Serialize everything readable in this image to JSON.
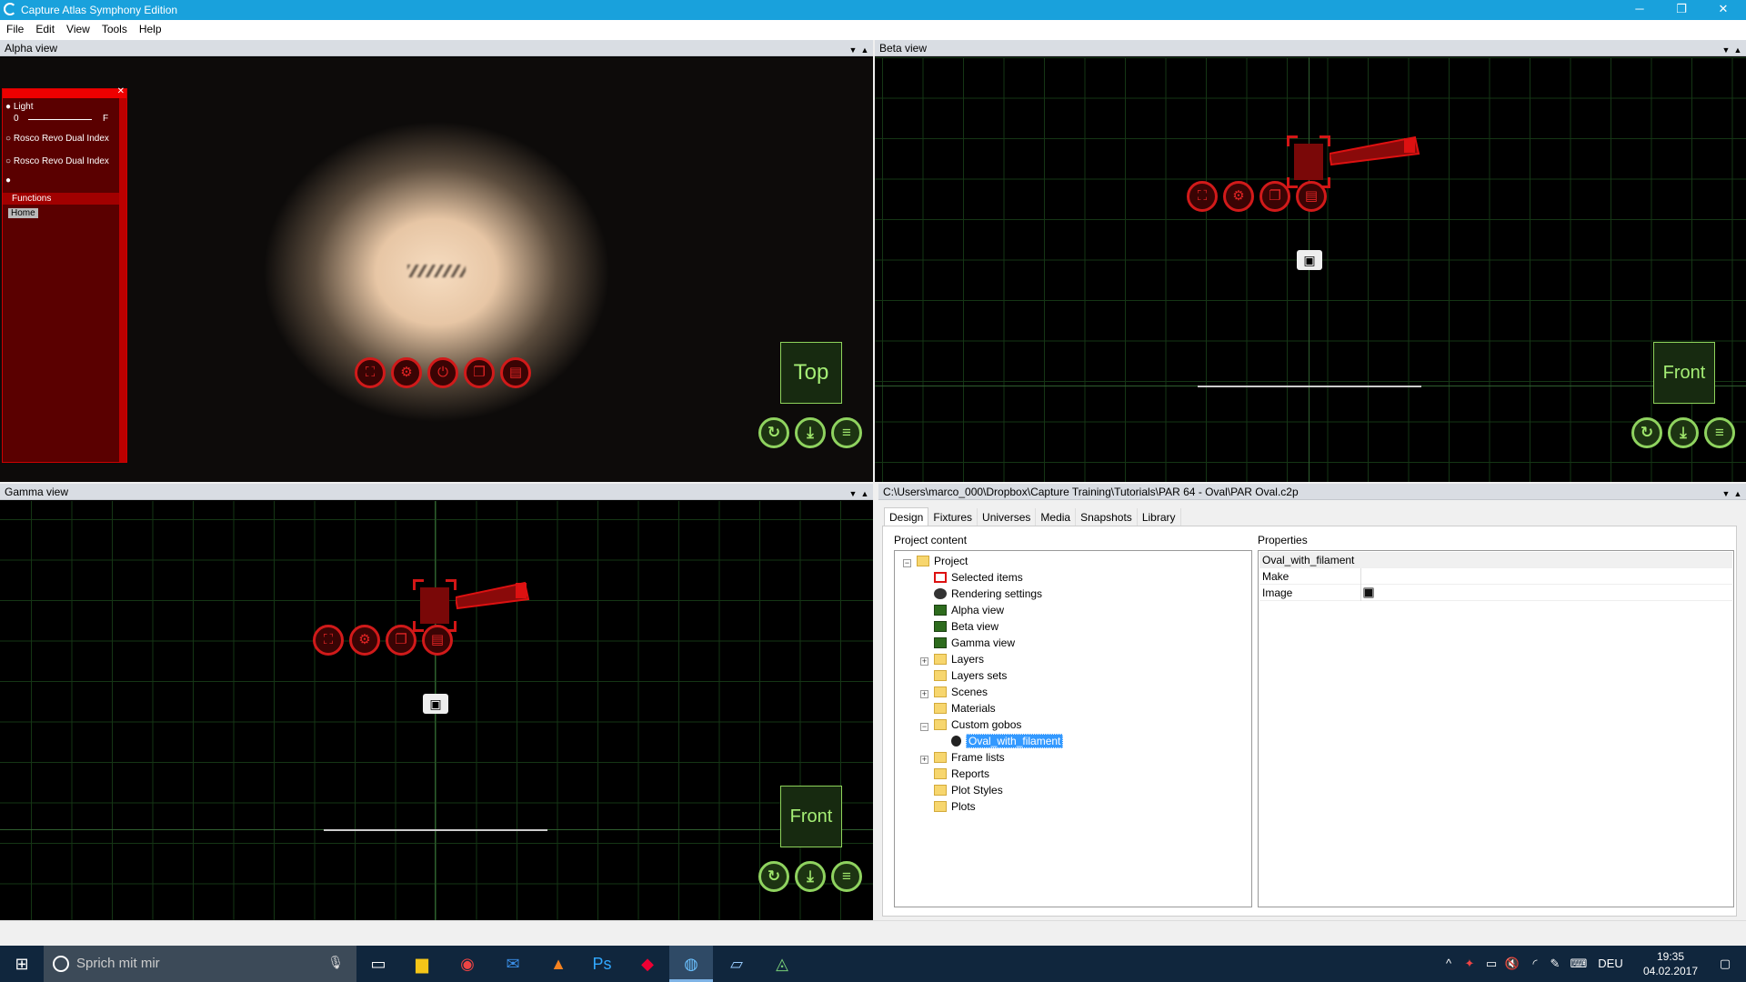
{
  "window": {
    "title": "Capture Atlas Symphony Edition",
    "controls": {
      "minimize": "─",
      "restore": "❐",
      "close": "✕"
    }
  },
  "menu": [
    "File",
    "Edit",
    "View",
    "Tools",
    "Help"
  ],
  "alpha_view": {
    "title": "Alpha view",
    "label": "Top",
    "panel": {
      "items": [
        "Light",
        "Rosco Revo Dual Index",
        "Rosco Revo Dual Index"
      ],
      "slider": {
        "min_label": "0",
        "max_label": "F"
      },
      "functions_label": "Functions",
      "home_label": "Home"
    }
  },
  "beta_view": {
    "title": "Beta view",
    "label": "Front"
  },
  "gamma_view": {
    "title": "Gamma view",
    "label": "Front"
  },
  "project": {
    "path": "C:\\Users\\marco_000\\Dropbox\\Capture Training\\Tutorials\\PAR 64 - Oval\\PAR Oval.c2p",
    "tabs": [
      "Design",
      "Fixtures",
      "Universes",
      "Media",
      "Snapshots",
      "Library"
    ],
    "active_tab": "Design",
    "content_title": "Project content",
    "properties_title": "Properties",
    "tree": [
      {
        "label": "Project",
        "level": 0,
        "icon": "folder",
        "expander": "−"
      },
      {
        "label": "Selected items",
        "level": 1,
        "icon": "selection",
        "expander": ""
      },
      {
        "label": "Rendering settings",
        "level": 1,
        "icon": "gear",
        "expander": ""
      },
      {
        "label": "Alpha view",
        "level": 1,
        "icon": "view",
        "expander": ""
      },
      {
        "label": "Beta view",
        "level": 1,
        "icon": "view",
        "expander": ""
      },
      {
        "label": "Gamma view",
        "level": 1,
        "icon": "view",
        "expander": ""
      },
      {
        "label": "Layers",
        "level": 1,
        "icon": "folder",
        "expander": "+"
      },
      {
        "label": "Layers sets",
        "level": 1,
        "icon": "folder",
        "expander": ""
      },
      {
        "label": "Scenes",
        "level": 1,
        "icon": "folder",
        "expander": "+"
      },
      {
        "label": "Materials",
        "level": 1,
        "icon": "folder",
        "expander": ""
      },
      {
        "label": "Custom gobos",
        "level": 1,
        "icon": "folder",
        "expander": "−"
      },
      {
        "label": "Oval_with_filament",
        "level": 2,
        "icon": "gobo",
        "expander": "",
        "selected": true
      },
      {
        "label": "Frame lists",
        "level": 1,
        "icon": "folder",
        "expander": "+"
      },
      {
        "label": "Reports",
        "level": 1,
        "icon": "folder",
        "expander": ""
      },
      {
        "label": "Plot Styles",
        "level": 1,
        "icon": "folder",
        "expander": ""
      },
      {
        "label": "Plots",
        "level": 1,
        "icon": "folder",
        "expander": ""
      }
    ],
    "properties": {
      "header": "Oval_with_filament",
      "rows": [
        {
          "key": "Make",
          "value": ""
        },
        {
          "key": "Image",
          "value": ""
        }
      ]
    }
  },
  "taskbar": {
    "search_placeholder": "Sprich mit mir",
    "language": "DEU",
    "time": "19:35",
    "date": "04.02.2017"
  },
  "colors": {
    "titlebar": "#19a1dc",
    "accent_green": "#8fd35f",
    "accent_red": "#d11a1a",
    "taskbar": "#10263d"
  }
}
